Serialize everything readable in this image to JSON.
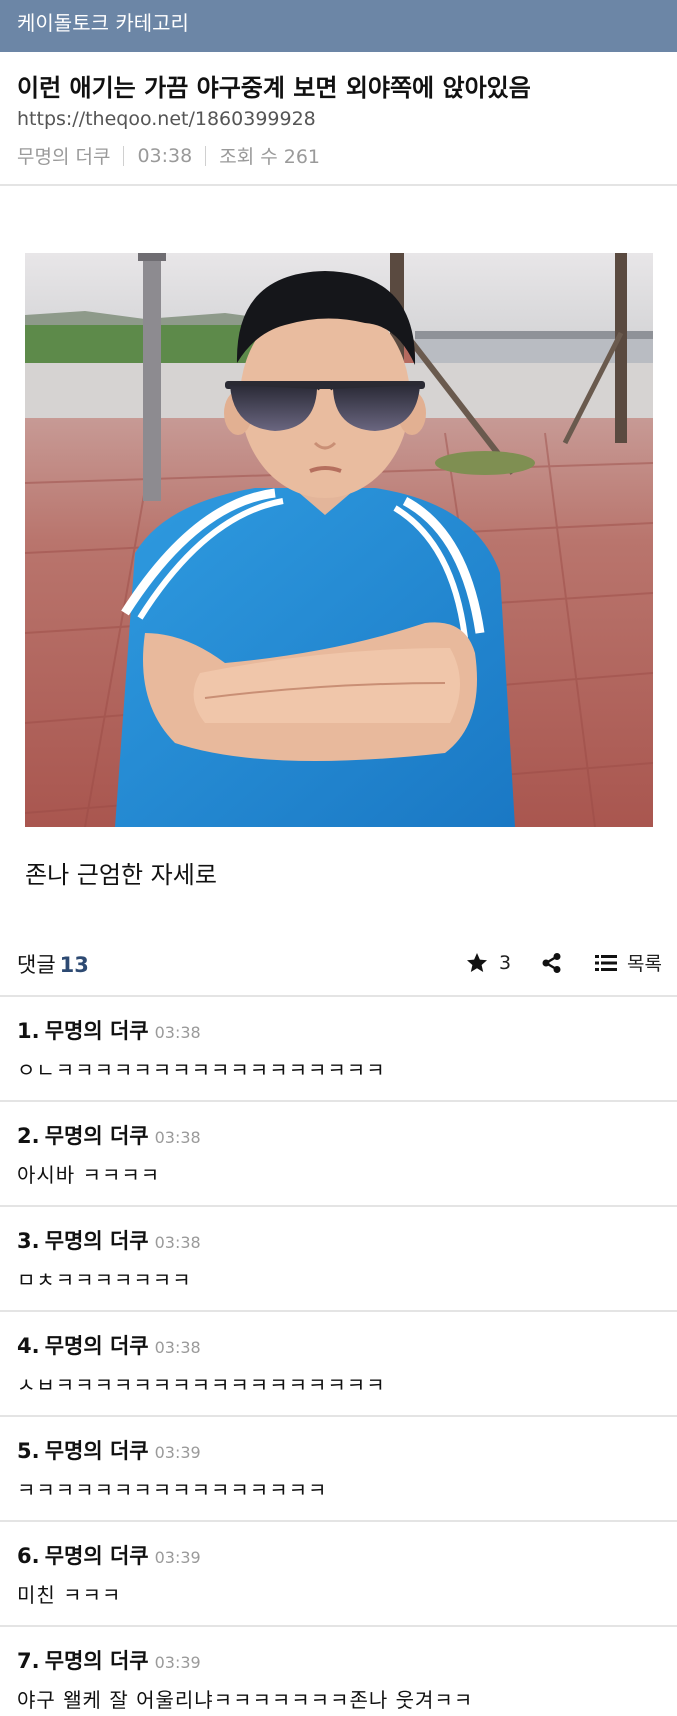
{
  "header": {
    "category_title": "케이돌토크 카테고리"
  },
  "post": {
    "title": "이런 애기는 가끔 야구중계 보면 외야쪽에 앉아있음",
    "url": "https://theqoo.net/1860399928",
    "author": "무명의 더쿠",
    "time": "03:38",
    "views_label": "조회 수 261",
    "body": "존나 근엄한 자세로"
  },
  "comment_bar": {
    "label": "댓글",
    "count": "13",
    "star_count": "3",
    "list_label": "목록"
  },
  "comments": [
    {
      "num": "1.",
      "author": "무명의 더쿠",
      "time": "03:38",
      "text": "ㅇㄴㅋㅋㅋㅋㅋㅋㅋㅋㅋㅋㅋㅋㅋㅋㅋㅋㅋ"
    },
    {
      "num": "2.",
      "author": "무명의 더쿠",
      "time": "03:38",
      "text": "아시바 ㅋㅋㅋㅋ"
    },
    {
      "num": "3.",
      "author": "무명의 더쿠",
      "time": "03:38",
      "text": "ㅁㅊㅋㅋㅋㅋㅋㅋㅋ"
    },
    {
      "num": "4.",
      "author": "무명의 더쿠",
      "time": "03:38",
      "text": "ㅅㅂㅋㅋㅋㅋㅋㅋㅋㅋㅋㅋㅋㅋㅋㅋㅋㅋㅋ"
    },
    {
      "num": "5.",
      "author": "무명의 더쿠",
      "time": "03:39",
      "text": "ㅋㅋㅋㅋㅋㅋㅋㅋㅋㅋㅋㅋㅋㅋㅋㅋ"
    },
    {
      "num": "6.",
      "author": "무명의 더쿠",
      "time": "03:39",
      "text": "미친 ㅋㅋㅋ"
    },
    {
      "num": "7.",
      "author": "무명의 더쿠",
      "time": "03:39",
      "text": "야구 왤케 잘 어울리냐ㅋㅋㅋㅋㅋㅋㅋ존나 웃겨ㅋㅋ"
    }
  ],
  "icons": {
    "star": "star-icon",
    "share": "share-icon",
    "list": "list-icon"
  },
  "colors": {
    "header_bg": "#6c86a6",
    "count_accent": "#2d4a72",
    "meta_gray": "#9a9a9a"
  }
}
